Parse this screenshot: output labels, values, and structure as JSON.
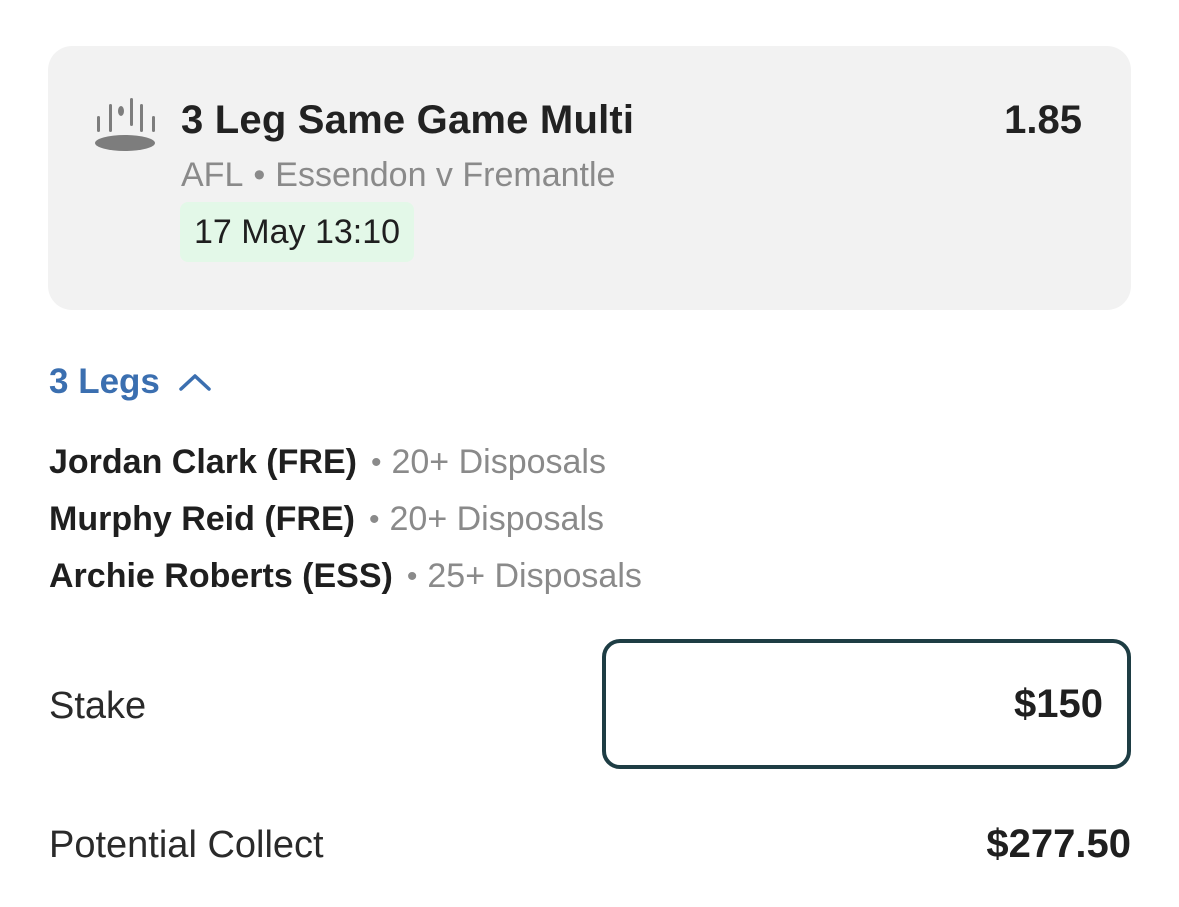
{
  "bet": {
    "icon": "goalposts-icon",
    "title": "3 Leg Same Game Multi",
    "odds": "1.85",
    "sport": "AFL",
    "separator": "•",
    "match": "Essendon v Fremantle",
    "start_time": "17 May 13:10"
  },
  "legs_toggle": {
    "label": "3 Legs",
    "icon": "chevron-up-icon",
    "color": "#3b6fb0"
  },
  "legs": [
    {
      "player": "Jordan Clark (FRE)",
      "separator": "•",
      "market": "20+ Disposals"
    },
    {
      "player": "Murphy Reid (FRE)",
      "separator": "•",
      "market": "20+ Disposals"
    },
    {
      "player": "Archie Roberts (ESS)",
      "separator": "•",
      "market": "25+ Disposals"
    }
  ],
  "stake": {
    "label": "Stake",
    "value": "$150"
  },
  "potential_collect": {
    "label": "Potential Collect",
    "value": "$277.50"
  },
  "colors": {
    "card_background": "#f2f2f2",
    "date_badge": "#e3f8e8",
    "input_border": "#1e3d44",
    "muted_text": "#8a8a8a"
  }
}
